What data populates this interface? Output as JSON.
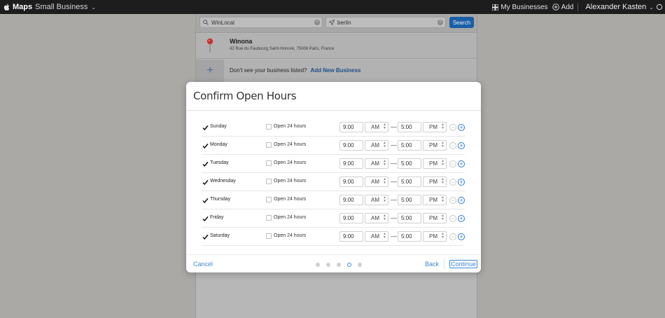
{
  "topbar": {
    "brand": "Maps",
    "brand_sub": "Small Business",
    "my_businesses": "My Businesses",
    "add": "Add",
    "user": "Alexander Kasten"
  },
  "search": {
    "query": "WinLocal",
    "location": "berlin",
    "button": "Search"
  },
  "result": {
    "name": "Winona",
    "address": "42 Rue du Faubourg Saint-Honoré, 75008 Paris, France"
  },
  "add_business": {
    "prompt": "Don't see your business listed?",
    "link": "Add New Business"
  },
  "modal": {
    "title": "Confirm Open Hours",
    "open24_label": "Open 24 hours",
    "days": [
      {
        "day": "Sunday",
        "checked": true,
        "open": "9:00",
        "open_ampm": "AM",
        "close": "5:00",
        "close_ampm": "PM"
      },
      {
        "day": "Monday",
        "checked": true,
        "open": "9:00",
        "open_ampm": "AM",
        "close": "5:00",
        "close_ampm": "PM"
      },
      {
        "day": "Tuesday",
        "checked": true,
        "open": "9:00",
        "open_ampm": "AM",
        "close": "5:00",
        "close_ampm": "PM"
      },
      {
        "day": "Wednesday",
        "checked": true,
        "open": "9:00",
        "open_ampm": "AM",
        "close": "5:00",
        "close_ampm": "PM"
      },
      {
        "day": "Thursday",
        "checked": true,
        "open": "9:00",
        "open_ampm": "AM",
        "close": "5:00",
        "close_ampm": "PM"
      },
      {
        "day": "Friday",
        "checked": true,
        "open": "9:00",
        "open_ampm": "AM",
        "close": "5:00",
        "close_ampm": "PM"
      },
      {
        "day": "Saturday",
        "checked": true,
        "open": "9:00",
        "open_ampm": "AM",
        "close": "5:00",
        "close_ampm": "PM"
      }
    ],
    "cancel": "Cancel",
    "back": "Back",
    "continue": "Continue",
    "step_count": 5,
    "active_step": 4
  },
  "icons": {
    "apple": "apple-logo-icon",
    "pin": "map-pin-icon",
    "plus": "plus-icon",
    "location_arrow": "location-arrow-icon"
  },
  "colors": {
    "accent": "#3b88d6",
    "search_button": "#1a5fa6",
    "pin": "#c9302c"
  }
}
